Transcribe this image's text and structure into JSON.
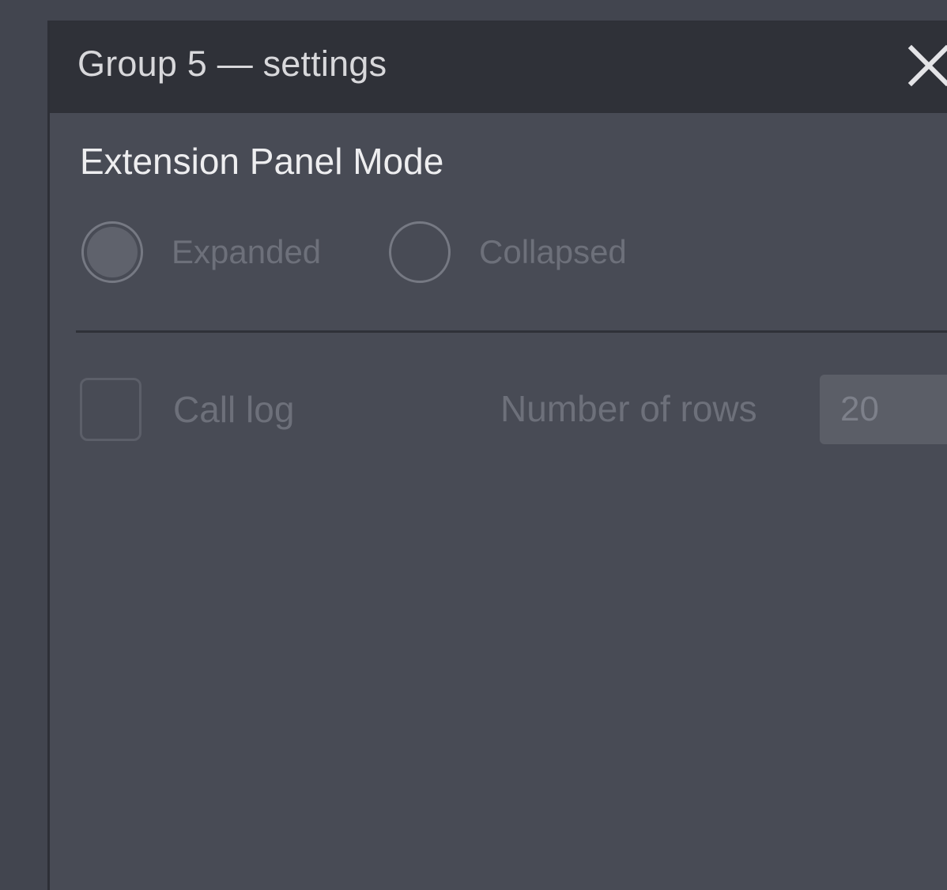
{
  "dialog": {
    "title": "Group 5 — settings",
    "close_icon": "close-icon"
  },
  "extension_panel": {
    "heading": "Extension Panel Mode",
    "options": [
      {
        "label": "Expanded",
        "selected": true
      },
      {
        "label": "Collapsed",
        "selected": false
      }
    ]
  },
  "call_log": {
    "label": "Call log",
    "checked": false,
    "rows_label": "Number of rows",
    "rows_value": "20"
  },
  "colors": {
    "background": "#42454f",
    "dialog": "#484b55",
    "titlebar": "#2f3138",
    "heading_text": "#eeeef0",
    "disabled_text": "#6d707a"
  }
}
